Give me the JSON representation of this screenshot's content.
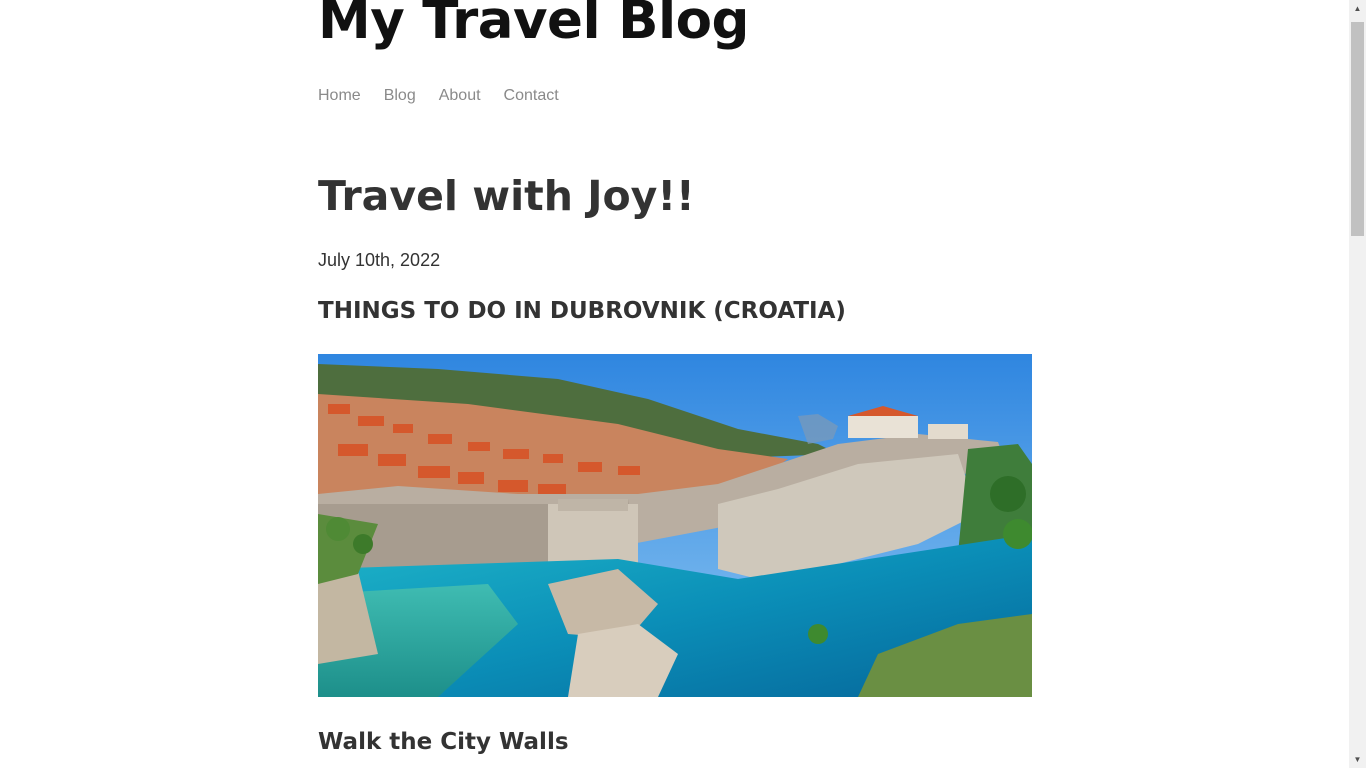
{
  "site": {
    "title": "My Travel Blog"
  },
  "nav": {
    "items": [
      {
        "label": "Home"
      },
      {
        "label": "Blog"
      },
      {
        "label": "About"
      },
      {
        "label": "Contact"
      }
    ]
  },
  "post": {
    "title": "Travel with Joy!!",
    "date": "July 10th, 2022",
    "section_heading": "THINGS TO DO IN DUBROVNIK (CROATIA)",
    "sub_heading": "Walk the City Walls"
  },
  "scrollbar": {
    "up_icon": "scroll-up-arrow-icon",
    "down_icon": "scroll-down-arrow-icon"
  }
}
